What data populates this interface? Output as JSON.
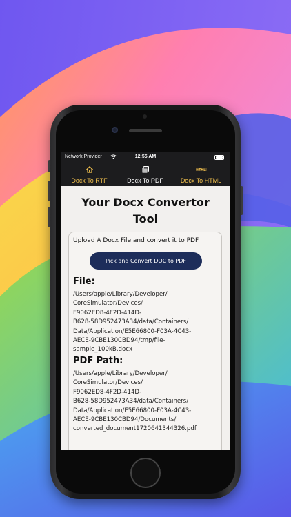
{
  "colors": {
    "tab_active_label": "#ffffff",
    "tab_inactive_label": "#f2c14e",
    "button_bg": "#1d2d5a",
    "content_bg": "#f2f0ee"
  },
  "status_bar": {
    "carrier": "Network Provider",
    "time": "12:55 AM",
    "icons": [
      "wifi-icon",
      "battery-icon"
    ]
  },
  "tabs": [
    {
      "label": "Docx To RTF",
      "icon": "home-icon",
      "active": false
    },
    {
      "label": "Docx To PDF",
      "icon": "pdf-icon",
      "active": true
    },
    {
      "label": "Docx To HTML",
      "icon": "html-icon",
      "active": false
    }
  ],
  "main": {
    "title": "Your Docx Convertor Tool",
    "subtitle": "Upload A Docx File and convert it to PDF",
    "convert_button": "Pick and Convert DOC to PDF",
    "file_label": "File:",
    "file_path": "/Users/apple/Library/Developer/\nCoreSimulator/Devices/\nF9062ED8-4F2D-414D-\nB628-58D952473A34/data/Containers/\nData/Application/E5E66800-F03A-4C43-\nAECE-9CBE130CBD94/tmp/file-\nsample_100kB.docx",
    "pdf_label": "PDF Path:",
    "pdf_path": "/Users/apple/Library/Developer/\nCoreSimulator/Devices/\nF9062ED8-4F2D-414D-\nB628-58D952473A34/data/Containers/\nData/Application/E5E66800-F03A-4C43-\nAECE-9CBE130CBD94/Documents/\nconverted_document1720641344326.pdf"
  }
}
